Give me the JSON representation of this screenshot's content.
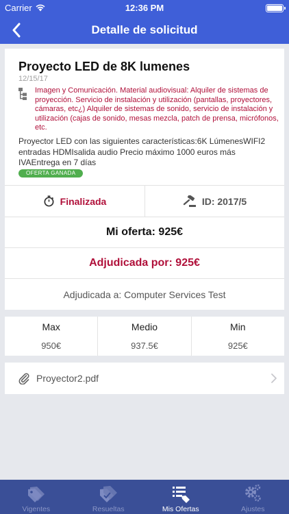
{
  "status_bar": {
    "carrier": "Carrier",
    "time": "12:36 PM"
  },
  "navbar": {
    "title": "Detalle de solicitud",
    "back_icon": "chevron-left-icon"
  },
  "request": {
    "title": "Proyecto LED de 8K lumenes",
    "date": "12/15/17",
    "category": "Imagen y Comunicación. Material audiovisual: Alquiler de sistemas de proyección. Servicio de instalación y utilización (pantallas, proyectores, cámaras, etc¿) Alquiler de sistemas de sonido, servicio de instalación y utilización (cajas de sonido, mesas mezcla, patch de prensa, micrófonos, etc.",
    "description": "Proyector LED con las siguientes características:6K LúmenesWIFI2 entradas HDMIsalida audio Precio máximo 1000 euros más IVAEntrega en 7 días",
    "badge": "OFERTA GANADA",
    "status": "Finalizada",
    "id_label": "ID: 2017/5",
    "my_offer": "Mi oferta: 925€",
    "awarded_for": "Adjudicada por: 925€",
    "awarded_to": "Adjudicada a: Computer Services Test"
  },
  "stats": [
    {
      "label": "Max",
      "value": "950€"
    },
    {
      "label": "Medio",
      "value": "937.5€"
    },
    {
      "label": "Min",
      "value": "925€"
    }
  ],
  "attachment": {
    "name": "Proyector2.pdf",
    "icon": "paperclip-icon"
  },
  "tabs": [
    {
      "label": "Vigentes",
      "icon": "tag-icon",
      "active": false
    },
    {
      "label": "Resueltas",
      "icon": "tag-check-icon",
      "active": false
    },
    {
      "label": "Mis Ofertas",
      "icon": "list-tag-icon",
      "active": true
    },
    {
      "label": "Ajustes",
      "icon": "gears-icon",
      "active": false
    }
  ],
  "colors": {
    "primary": "#3f5fd8",
    "tabbar": "#3a4f97",
    "accent_red": "#b0103a",
    "badge_green": "#50ae4e"
  }
}
